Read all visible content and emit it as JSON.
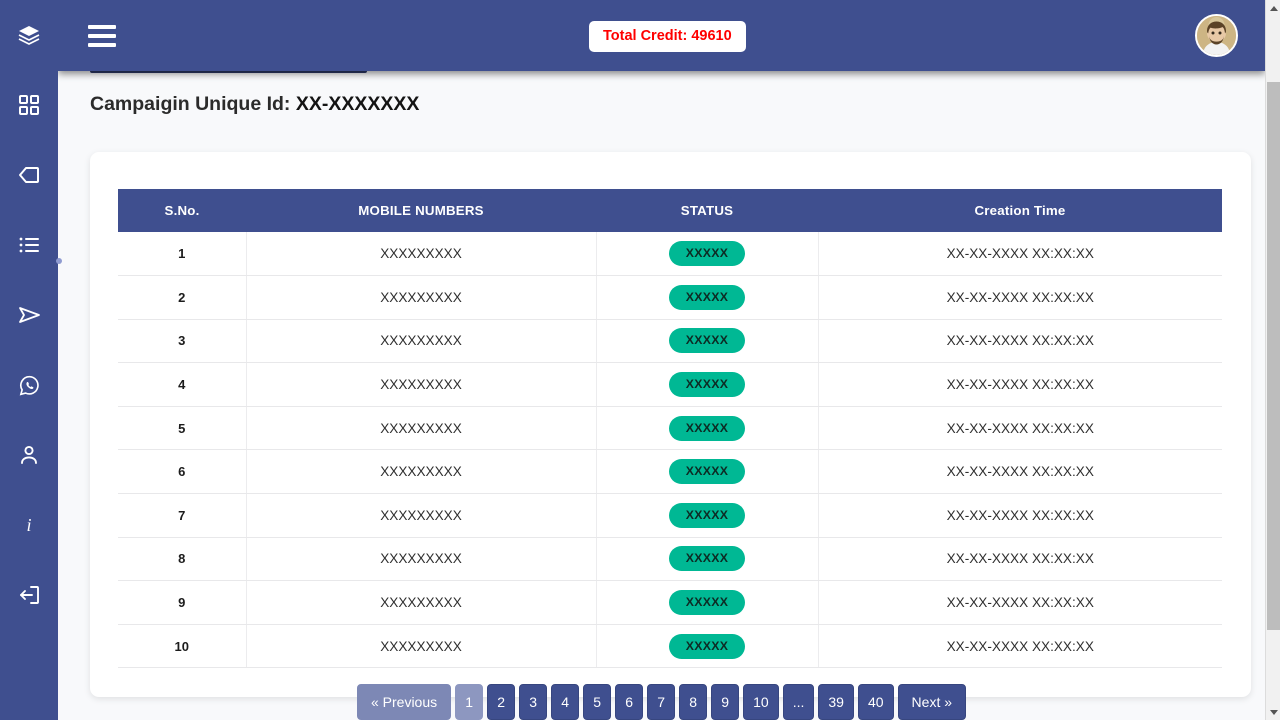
{
  "sidebar": {
    "items": [
      {
        "name": "layers-icon",
        "label": "Layers"
      },
      {
        "name": "grid-icon",
        "label": "Dashboard"
      },
      {
        "name": "tag-icon",
        "label": "Tag"
      },
      {
        "name": "list-icon",
        "label": "Lists"
      },
      {
        "name": "send-icon",
        "label": "Send"
      },
      {
        "name": "whatsapp-icon",
        "label": "WhatsApp"
      },
      {
        "name": "user-icon",
        "label": "Profile"
      },
      {
        "name": "info-icon",
        "label": "i"
      },
      {
        "name": "logout-icon",
        "label": "Logout"
      }
    ]
  },
  "header": {
    "menu_label": "Menu",
    "credit_label": "Total Credit: 49610",
    "credit_color": "#ff0000",
    "bar_color": "#3f4f8f",
    "avatar_label": "User avatar"
  },
  "page": {
    "title_prefix": "Campaigin Unique Id:",
    "title_value": "XX-XXXXXXX"
  },
  "table": {
    "columns": [
      "S.No.",
      "MOBILE NUMBERS",
      "STATUS",
      "Creation Time"
    ],
    "header_bg": "#3f4f8f",
    "badge_color": "#00b894",
    "rows": [
      {
        "sno": "1",
        "mobile": "XXXXXXXXX",
        "status": "XXXXX",
        "created": "XX-XX-XXXX XX:XX:XX"
      },
      {
        "sno": "2",
        "mobile": "XXXXXXXXX",
        "status": "XXXXX",
        "created": "XX-XX-XXXX XX:XX:XX"
      },
      {
        "sno": "3",
        "mobile": "XXXXXXXXX",
        "status": "XXXXX",
        "created": "XX-XX-XXXX XX:XX:XX"
      },
      {
        "sno": "4",
        "mobile": "XXXXXXXXX",
        "status": "XXXXX",
        "created": "XX-XX-XXXX XX:XX:XX"
      },
      {
        "sno": "5",
        "mobile": "XXXXXXXXX",
        "status": "XXXXX",
        "created": "XX-XX-XXXX XX:XX:XX"
      },
      {
        "sno": "6",
        "mobile": "XXXXXXXXX",
        "status": "XXXXX",
        "created": "XX-XX-XXXX XX:XX:XX"
      },
      {
        "sno": "7",
        "mobile": "XXXXXXXXX",
        "status": "XXXXX",
        "created": "XX-XX-XXXX XX:XX:XX"
      },
      {
        "sno": "8",
        "mobile": "XXXXXXXXX",
        "status": "XXXXX",
        "created": "XX-XX-XXXX XX:XX:XX"
      },
      {
        "sno": "9",
        "mobile": "XXXXXXXXX",
        "status": "XXXXX",
        "created": "XX-XX-XXXX XX:XX:XX"
      },
      {
        "sno": "10",
        "mobile": "XXXXXXXXX",
        "status": "XXXXX",
        "created": "XX-XX-XXXX XX:XX:XX"
      }
    ]
  },
  "pagination": {
    "previous_label": "« Previous",
    "next_label": "Next »",
    "current_page": "1",
    "pages": [
      "1",
      "2",
      "3",
      "4",
      "5",
      "6",
      "7",
      "8",
      "9",
      "10",
      "...",
      "39",
      "40"
    ]
  }
}
